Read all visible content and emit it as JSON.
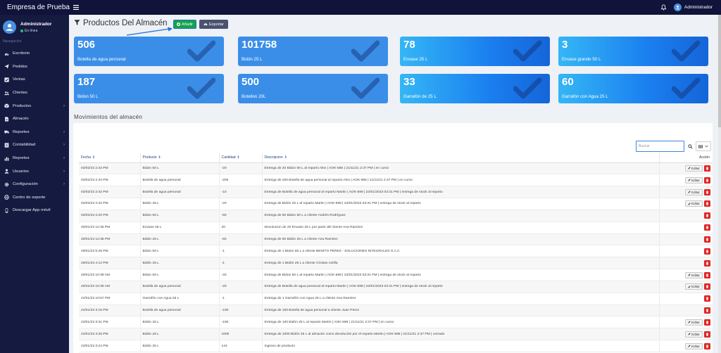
{
  "app": {
    "title": "Empresa de Prueba"
  },
  "topbar": {
    "user_name": "Administrador"
  },
  "sidebar": {
    "user_name": "Administrador",
    "user_status": "En línea",
    "nav_header": "Navegación",
    "items": [
      {
        "label": "Escritorio",
        "icon": "gauge-icon",
        "has_children": false
      },
      {
        "label": "Pedidos",
        "icon": "paper-plane-icon",
        "has_children": false
      },
      {
        "label": "Ventas",
        "icon": "check-square-icon",
        "has_children": false
      },
      {
        "label": "Clientes",
        "icon": "users-icon",
        "has_children": false
      },
      {
        "label": "Productos",
        "icon": "box-icon",
        "has_children": true
      },
      {
        "label": "Almacén",
        "icon": "document-icon",
        "has_children": false
      },
      {
        "label": "Reportes",
        "icon": "truck-icon",
        "has_children": true
      },
      {
        "label": "Contabilidad",
        "icon": "ledger-icon",
        "has_children": true
      },
      {
        "label": "Reportes",
        "icon": "bar-chart-icon",
        "has_children": true
      },
      {
        "label": "Usuarios",
        "icon": "user-icon",
        "has_children": true
      },
      {
        "label": "Configuración",
        "icon": "gear-icon",
        "has_children": true
      },
      {
        "label": "Centro de soporte",
        "icon": "globe-icon",
        "has_children": false
      },
      {
        "label": "Descargar App móvil",
        "icon": "mobile-icon",
        "has_children": false
      }
    ]
  },
  "page": {
    "title": "Productos Del Almacén",
    "add_label": "Añadir",
    "export_label": "Exportar",
    "section_title": "Movimientos del almacén",
    "search_placeholder": "Buscar"
  },
  "colors": {
    "sidebar_bg": "#151a40",
    "topbar_bg": "#10143a",
    "card_blue": "#3a8ee8",
    "add_green": "#15a34a",
    "delete_red": "#e02626"
  },
  "cards": [
    {
      "value": "506",
      "label": "Botella de agua personal",
      "style": "blue"
    },
    {
      "value": "101758",
      "label": "Bidón 25 L",
      "style": "blue"
    },
    {
      "value": "78",
      "label": "Envase 25 L",
      "style": "grad"
    },
    {
      "value": "3",
      "label": "Envase grande 50 L",
      "style": "grad"
    },
    {
      "value": "187",
      "label": "Bidon 50 L",
      "style": "blue"
    },
    {
      "value": "500",
      "label": "Botellon 20L",
      "style": "blue"
    },
    {
      "value": "33",
      "label": "Garrafón de 25 L",
      "style": "grad"
    },
    {
      "value": "60",
      "label": "Garrafón con Agua 25 L",
      "style": "grad"
    }
  ],
  "table": {
    "headers": [
      "Fecha",
      "Producto",
      "Cantidad",
      "Descripcion",
      "Acción"
    ],
    "edit_label": "Editar",
    "rows": [
      {
        "fecha": "03/02/23 2:34 PM",
        "producto": "Bidon 50 L",
        "cantidad": "-20",
        "descripcion": "Entrega de 20 Bidon 50 L al reparto Alex | AOK-585 | 21/11/21 2:37 PM | en curso",
        "editable": true
      },
      {
        "fecha": "03/02/23 2:34 PM",
        "producto": "Botella de agua personal",
        "cantidad": "-200",
        "descripcion": "Entrega de 200 Botella de agua personal al reparto Alex | AOK-585 | 21/11/21 2:37 PM | en curso",
        "editable": true
      },
      {
        "fecha": "03/02/23 2:32 PM",
        "producto": "Botella de agua personal",
        "cantidad": "-10",
        "descripcion": "Entrega de Botella de agua personal al reparto Martin | AOK-598 | 23/01/2023 03:31 PM | entrega de stock al reparto",
        "editable": true
      },
      {
        "fecha": "03/02/23 2:32 PM",
        "producto": "Bidón 25 L",
        "cantidad": "-20",
        "descripcion": "Entrega de Bidón 25 L al reparto Martin | AOK-598 | 23/01/2023 03:31 PM | entrega de stock al reparto",
        "editable": true
      },
      {
        "fecha": "03/02/23 2:20 PM",
        "producto": "Bidon 50 L",
        "cantidad": "-50",
        "descripcion": "Entrega de 50 Bidon 50 L a cliente Andrés Rodríguez",
        "editable": false
      },
      {
        "fecha": "30/01/23 12:35 PM",
        "producto": "Envase 25 L",
        "cantidad": "20",
        "descripcion": "Devolucion de 20 Envase 25 L por parte del cliente Ana Ramirez",
        "editable": false
      },
      {
        "fecha": "30/01/23 12:35 PM",
        "producto": "Bidón 25 L",
        "cantidad": "-50",
        "descripcion": "Entrega de 50 Bidón 25 L a cliente Ana Ramirez",
        "editable": false
      },
      {
        "fecha": "29/01/23 5:25 PM",
        "producto": "Bidon 50 L",
        "cantidad": "-1",
        "descripcion": "Entrega de 1 Bidon 50 L a cliente BENITO PEREZ - SOLUCIONES INTEGRALES S.A.C",
        "editable": false
      },
      {
        "fecha": "26/01/23 4:12 PM",
        "producto": "Bidón 25 L",
        "cantidad": "-1",
        "descripcion": "Entrega de 1 Bidón 25 L a cliente Cristian Utrilla",
        "editable": false
      },
      {
        "fecha": "25/01/23 10:39 AM",
        "producto": "Bidon 50 L",
        "cantidad": "-40",
        "descripcion": "Entrega de Bidon 50 L al reparto Martin | AOK-598 | 23/01/2023 03:31 PM | entrega de stock al reparto",
        "editable": true
      },
      {
        "fecha": "25/01/23 10:35 AM",
        "producto": "Botella de agua personal",
        "cantidad": "-20",
        "descripcion": "Entrega de Botella de agua personal al reparto Martin | AOK-598 | 23/01/2023 03:31 PM | entrega de stock al reparto",
        "editable": true
      },
      {
        "fecha": "24/01/23 10:57 PM",
        "producto": "Garrafón con Agua 25 L",
        "cantidad": "-1",
        "descripcion": "Entrega de 1 Garrafón con Agua 25 L a cliente Ana Ramirez",
        "editable": false
      },
      {
        "fecha": "24/01/23 3:15 PM",
        "producto": "Botella de agua personal",
        "cantidad": "-100",
        "descripcion": "Entrega de 100 Botella de agua personal a cliente Juan Perez",
        "editable": false
      },
      {
        "fecha": "23/01/23 3:31 PM",
        "producto": "Bidón 25 L",
        "cantidad": "-100",
        "descripcion": "Entrega de 100 Bidón 25 L al reparto Martin | AOK-598 | 21/11/21 2:37 PM | en curso",
        "editable": true
      },
      {
        "fecha": "23/01/23 3:26 PM",
        "producto": "Bidón 25 L",
        "cantidad": "1000",
        "descripcion": "Entrega de 1000 Bidón 25 L al almacén como devolución por el reparto Martin | AOK-585 | 21/11/21 2:37 PM | cerrado",
        "editable": true
      },
      {
        "fecha": "23/01/23 3:24 PM",
        "producto": "Bidón 25 L",
        "cantidad": "144",
        "descripcion": "Ingreso de producto",
        "editable": true
      }
    ]
  }
}
